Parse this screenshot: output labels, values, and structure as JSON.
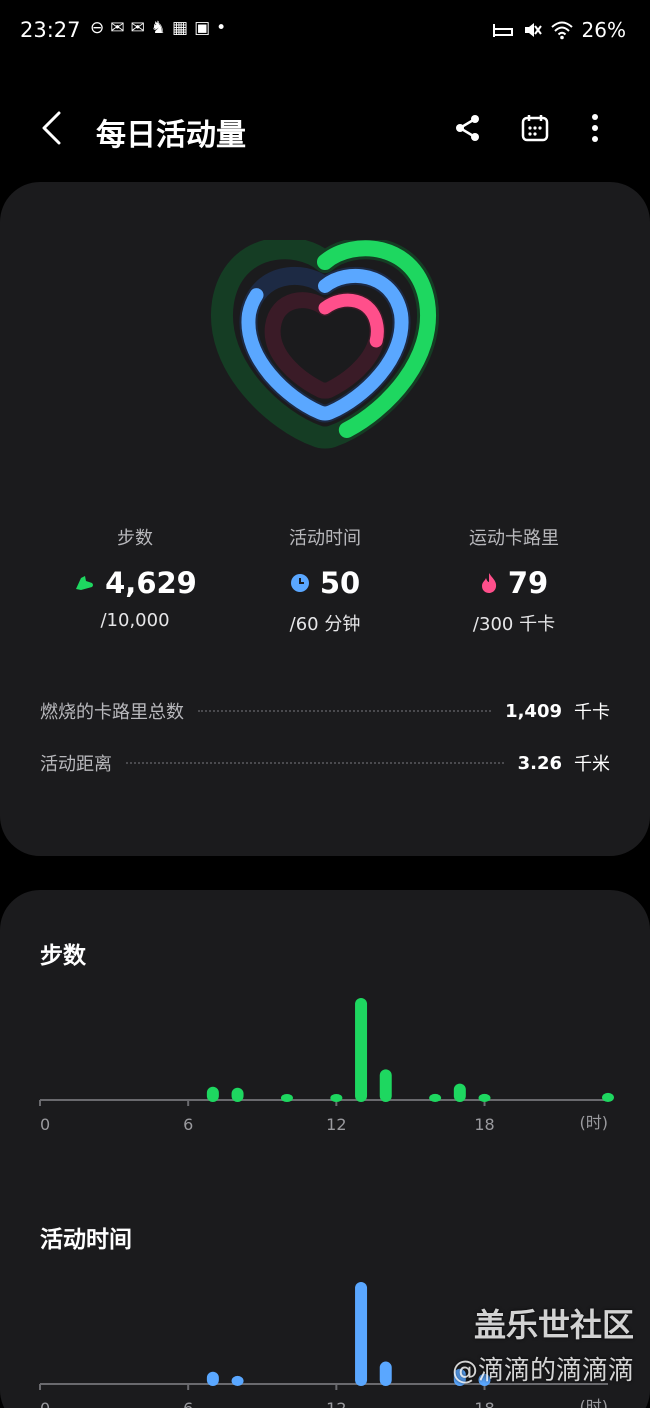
{
  "status_bar": {
    "time": "23:27",
    "left_icons": [
      "⊖",
      "✉",
      "✉",
      "♞",
      "▦",
      "▣",
      "•"
    ],
    "right_icons": [
      "⇥",
      "🔇",
      "wifi"
    ],
    "battery": "26%"
  },
  "header": {
    "title": "每日活动量"
  },
  "colors": {
    "steps": "#1ed760",
    "active": "#5aa7ff",
    "calories": "#ff4f8b",
    "card": "#1b1b1d"
  },
  "rings": {
    "steps_progress": 0.4629,
    "active_progress": 0.8333,
    "calories_progress": 0.2633
  },
  "stats": {
    "steps": {
      "label": "步数",
      "value": "4,629",
      "goal": "/10,000",
      "icon": "shoe-icon"
    },
    "active_time": {
      "label": "活动时间",
      "value": "50",
      "goal": "/60 分钟",
      "icon": "clock-icon"
    },
    "calories": {
      "label": "运动卡路里",
      "value": "79",
      "goal": "/300 千卡",
      "icon": "flame-icon"
    }
  },
  "details": {
    "total_calories": {
      "label": "燃烧的卡路里总数",
      "value": "1,409",
      "unit": "千卡"
    },
    "distance": {
      "label": "活动距离",
      "value": "3.26",
      "unit": "千米"
    }
  },
  "charts": {
    "steps_title": "步数",
    "active_title": "活动时间",
    "x_ticks": [
      "0",
      "6",
      "12",
      "18"
    ],
    "x_unit": "(时)"
  },
  "chart_data": [
    {
      "type": "bar",
      "title": "步数",
      "xlabel": "(时)",
      "x": [
        7,
        8,
        10,
        12,
        13,
        14,
        16,
        17,
        18,
        23
      ],
      "values": [
        0.13,
        0.12,
        0.05,
        0.05,
        1.0,
        0.3,
        0.06,
        0.16,
        0.06,
        0.07
      ],
      "xlim": [
        0,
        23
      ],
      "color": "#1ed760"
    },
    {
      "type": "bar",
      "title": "活动时间",
      "xlabel": "(时)",
      "x": [
        7,
        8,
        13,
        14,
        17,
        18
      ],
      "values": [
        0.12,
        0.08,
        1.0,
        0.22,
        0.15,
        0.1
      ],
      "xlim": [
        0,
        23
      ],
      "color": "#5aa7ff"
    }
  ],
  "watermark": {
    "line1": "盖乐世社区",
    "line2": "@滴滴的滴滴滴"
  }
}
